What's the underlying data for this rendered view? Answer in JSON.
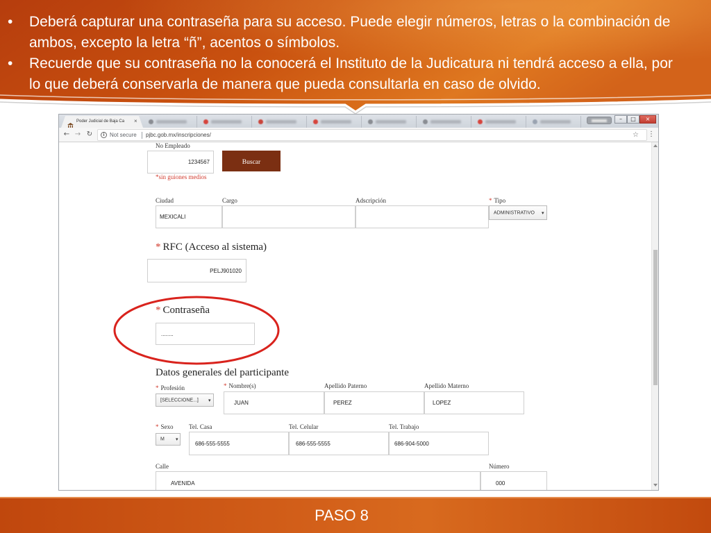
{
  "slide": {
    "bullets": [
      "Deberá capturar una contraseña para su acceso. Puede elegir números, letras o la combinación de ambos, excepto la letra “ñ”, acentos o símbolos.",
      "Recuerde que su contraseña no la conocerá el Instituto de la Judicatura ni tendrá acceso a ella, por lo que deberá conservarla de manera que pueda consultarla en caso de olvido."
    ],
    "footer_title": "PASO 8"
  },
  "theme": {
    "slide_orange": "#c8500f",
    "highlight_ring": "#d9231d",
    "button_brown": "#7b2f12",
    "required_red": "#d23b2e"
  },
  "browser": {
    "active_tab_title": "Poder Judicial de Baja Ca",
    "security_label": "Not secure",
    "url": "pjbc.gob.mx/inscripciones/",
    "icons": {
      "tab": "building-favicon-icon",
      "tab_close": "close-icon",
      "back": "back-arrow-icon",
      "forward": "forward-arrow-icon",
      "reload": "reload-icon",
      "security": "info-icon",
      "bookmark": "star-icon",
      "menu": "kebab-menu-icon",
      "select": "chevron-down-icon"
    }
  },
  "form": {
    "required_mark": "*",
    "no_empleado": {
      "label": "No Empleado",
      "value": "1234567"
    },
    "search_button": "Buscar",
    "hint": "*sin guiones medios",
    "ciudad": {
      "label": "Ciudad",
      "value": "MEXICALI"
    },
    "cargo": {
      "label": "Cargo"
    },
    "adscripcion": {
      "label": "Adscripción"
    },
    "tipo": {
      "label": "Tipo",
      "value": "ADMINISTRATIVO"
    },
    "rfc": {
      "label": "RFC (Acceso al sistema)",
      "value": "PELJ901020"
    },
    "contrasena": {
      "label": "Contraseña",
      "value": "........"
    },
    "section_title": "Datos generales del participante",
    "profesion": {
      "label": "Profesión",
      "value": "[SELECCIONE...]"
    },
    "nombre": {
      "label": "Nombre(s)",
      "value": "JUAN"
    },
    "apellido_paterno": {
      "label": "Apellido Paterno",
      "value": "PEREZ"
    },
    "apellido_materno": {
      "label": "Apellido Materno",
      "value": "LOPEZ"
    },
    "sexo": {
      "label": "Sexo",
      "value": "M"
    },
    "tel_casa": {
      "label": "Tel. Casa",
      "value": "686-555-5555"
    },
    "tel_celular": {
      "label": "Tel. Celular",
      "value": "686-555-5555"
    },
    "tel_trabajo": {
      "label": "Tel. Trabajo",
      "value": "686-904-5000"
    },
    "calle": {
      "label": "Calle",
      "value": "AVENIDA"
    },
    "numero": {
      "label": "Número",
      "value": "000"
    }
  }
}
